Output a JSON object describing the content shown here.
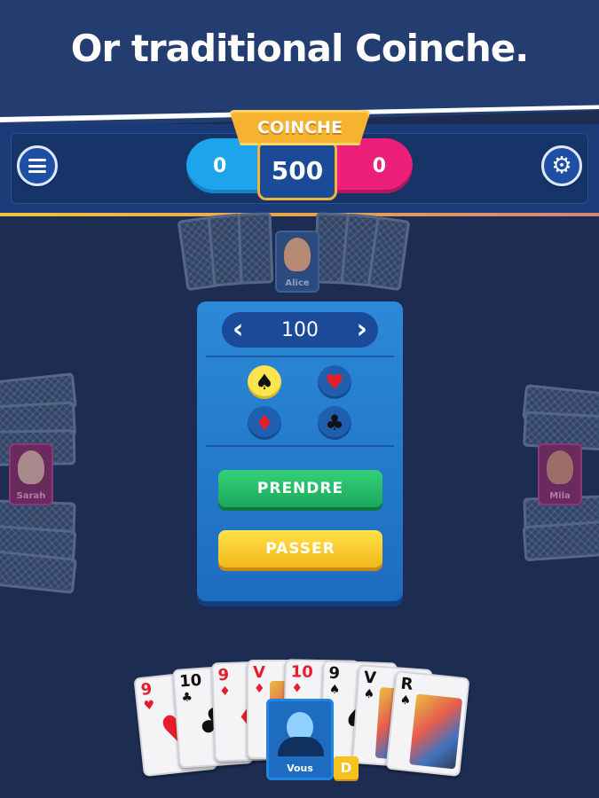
{
  "banner": {
    "title": "Or traditional Coinche."
  },
  "header": {
    "menu_icon": "hamburger-menu-icon",
    "settings_icon": "gear-icon",
    "mode_label": "COINCHE",
    "score_team_left": "0",
    "score_target": "500",
    "score_team_right": "0",
    "team_left_color": "#1ea4ec",
    "team_right_color": "#ec1f79"
  },
  "players": {
    "top": {
      "name": "Alice"
    },
    "left": {
      "name": "Sarah"
    },
    "right": {
      "name": "Mila"
    },
    "bottom": {
      "name": "Vous",
      "dealer_badge": "D"
    }
  },
  "bid_panel": {
    "prev_icon": "chevron-left-icon",
    "next_icon": "chevron-right-icon",
    "value": "100",
    "suits": [
      {
        "name": "spades",
        "glyph": "♠",
        "selected": true
      },
      {
        "name": "hearts",
        "glyph": "♥",
        "selected": false
      },
      {
        "name": "diamonds",
        "glyph": "♦",
        "selected": false
      },
      {
        "name": "clubs",
        "glyph": "♣",
        "selected": false
      }
    ],
    "take_label": "PRENDRE",
    "pass_label": "PASSER"
  },
  "hand": [
    {
      "rank": "9",
      "suit": "♥",
      "color": "red"
    },
    {
      "rank": "10",
      "suit": "♣",
      "color": "black"
    },
    {
      "rank": "9",
      "suit": "♦",
      "color": "red"
    },
    {
      "rank": "V",
      "suit": "♦",
      "color": "red"
    },
    {
      "rank": "10",
      "suit": "♦",
      "color": "red"
    },
    {
      "rank": "9",
      "suit": "♠",
      "color": "black"
    },
    {
      "rank": "V",
      "suit": "♠",
      "color": "black"
    },
    {
      "rank": "R",
      "suit": "♠",
      "color": "black"
    }
  ]
}
